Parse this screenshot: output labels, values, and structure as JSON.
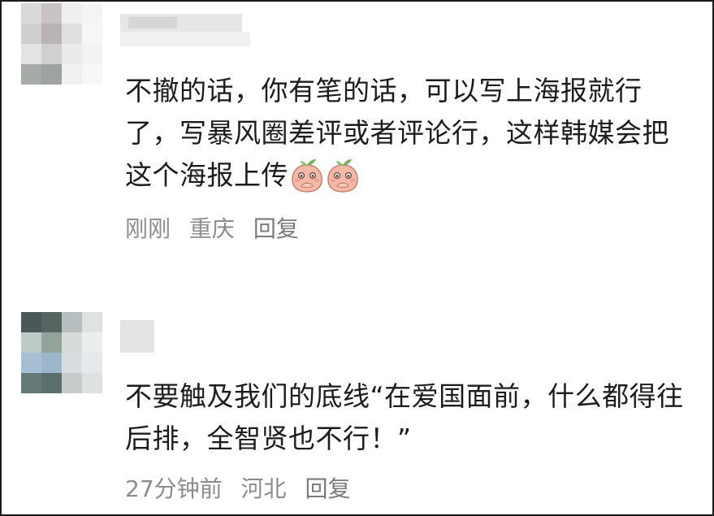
{
  "comments": [
    {
      "text": "不撤的话，你有笔的话，可以写上海报就行了，写暴风圈差评或者评论行，这样韩媒会把这个海报上传",
      "emojis": [
        "peach-covering-mouth-emoji",
        "peach-covering-mouth-emoji"
      ],
      "time": "刚刚",
      "location": "重庆",
      "reply_label": "回复",
      "avatar_colors": [
        "#d9d9d9",
        "#c9c3c6",
        "#efefef",
        "#f4f4f4",
        "#cfcfcf",
        "#b9b2b6",
        "#e0e0e0",
        "#f6f6f6",
        "#e3e3e3",
        "#d2cfd1",
        "#ebebeb",
        "#f2f2f2",
        "#a6aba8",
        "#9ea39f",
        "#f0f0f0",
        "#f7f7f7"
      ]
    },
    {
      "text": "不要触及我们的底线“在爱国面前，什么都得往后排，全智贤也不行！”",
      "emojis": [],
      "time": "27分钟前",
      "location": "河北",
      "reply_label": "回复",
      "avatar_colors": [
        "#4a5958",
        "#55655f",
        "#b6bfbd",
        "#dfe2e1",
        "#bfc9c7",
        "#93a29b",
        "#d7dcdb",
        "#eceeed",
        "#a7bfd4",
        "#9cb7cc",
        "#d8dde2",
        "#e6e8ea",
        "#657a76",
        "#5c6e69",
        "#c5ccca",
        "#dde1e0"
      ]
    }
  ]
}
